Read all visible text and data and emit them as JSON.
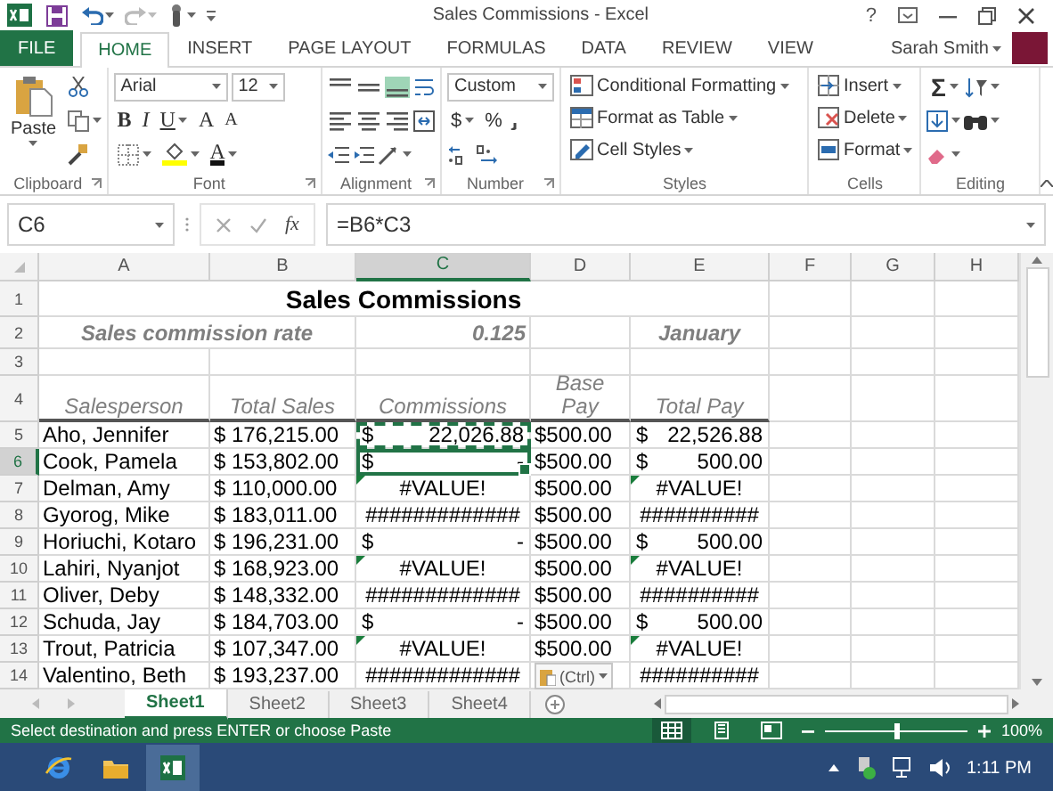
{
  "window": {
    "title": "Sales Commissions - Excel",
    "help": "?",
    "account": "Sarah Smith"
  },
  "ribbon_tabs": [
    {
      "label": "FILE",
      "kind": "file",
      "selected": false
    },
    {
      "label": "HOME",
      "kind": "tab",
      "selected": true
    },
    {
      "label": "INSERT",
      "kind": "tab",
      "selected": false
    },
    {
      "label": "PAGE LAYOUT",
      "kind": "tab",
      "selected": false
    },
    {
      "label": "FORMULAS",
      "kind": "tab",
      "selected": false
    },
    {
      "label": "DATA",
      "kind": "tab",
      "selected": false
    },
    {
      "label": "REVIEW",
      "kind": "tab",
      "selected": false
    },
    {
      "label": "VIEW",
      "kind": "tab",
      "selected": false
    }
  ],
  "ribbon": {
    "clipboard": {
      "paste": "Paste",
      "label": "Clipboard"
    },
    "font": {
      "name": "Arial",
      "size": "12",
      "bold": "B",
      "italic": "I",
      "underline": "U",
      "grow": "A",
      "shrink": "A",
      "font_color": "A",
      "label": "Font"
    },
    "alignment": {
      "label": "Alignment"
    },
    "number": {
      "format": "Custom",
      "currency": "$",
      "percent": "%",
      "label": "Number"
    },
    "styles": {
      "items": [
        "Conditional Formatting",
        "Format as Table",
        "Cell Styles"
      ],
      "label": "Styles"
    },
    "cells": {
      "items": [
        "Insert",
        "Delete",
        "Format"
      ],
      "label": "Cells"
    },
    "editing": {
      "sum": "Σ",
      "label": "Editing"
    }
  },
  "formula_bar": {
    "name_box": "C6",
    "insert_function": "fx",
    "formula": "=B6*C3"
  },
  "sheet": {
    "columns": [
      {
        "label": "A",
        "selected": false
      },
      {
        "label": "B",
        "selected": false
      },
      {
        "label": "C",
        "selected": true
      },
      {
        "label": "D",
        "selected": false
      },
      {
        "label": "E",
        "selected": false
      },
      {
        "label": "F",
        "selected": false
      },
      {
        "label": "G",
        "selected": false
      },
      {
        "label": "H",
        "selected": false
      }
    ],
    "top_rows": [
      {
        "label": "1",
        "selected": false
      },
      {
        "label": "2",
        "selected": false
      },
      {
        "label": "3",
        "selected": false
      },
      {
        "label": "4",
        "selected": false
      }
    ],
    "title": "Sales Commissions",
    "rate_label": "Sales commission rate",
    "rate": "0.125",
    "month": "January",
    "headers": [
      "Salesperson",
      "Total Sales",
      "Commissions",
      "Base Pay",
      "Total Pay"
    ],
    "rows": [
      {
        "label": "5",
        "selected": false,
        "name": "Aho, Jennifer",
        "total_sales": "$ 176,215.00",
        "commission": {
          "kind": "accounting",
          "symbol": "$",
          "value": "22,026.88",
          "flagged": false,
          "marquee": true,
          "active": false
        },
        "base_pay": "$500.00",
        "total_pay": {
          "kind": "accounting",
          "symbol": "$",
          "value": "22,526.88",
          "flagged": false
        }
      },
      {
        "label": "6",
        "selected": true,
        "name": "Cook, Pamela",
        "total_sales": "$ 153,802.00",
        "commission": {
          "kind": "accounting",
          "symbol": "$",
          "value": "-",
          "flagged": false,
          "marquee": false,
          "active": true
        },
        "base_pay": "$500.00",
        "total_pay": {
          "kind": "accounting",
          "symbol": "$",
          "value": "500.00",
          "flagged": false
        }
      },
      {
        "label": "7",
        "selected": false,
        "name": "Delman, Amy",
        "total_sales": "$ 110,000.00",
        "commission": {
          "kind": "error",
          "text": "#VALUE!",
          "flagged": true,
          "marquee": false,
          "active": false
        },
        "base_pay": "$500.00",
        "total_pay": {
          "kind": "error",
          "text": "#VALUE!",
          "flagged": true
        }
      },
      {
        "label": "8",
        "selected": false,
        "name": "Gyorog, Mike",
        "total_sales": "$ 183,011.00",
        "commission": {
          "kind": "overflow",
          "text": "#############",
          "flagged": false,
          "marquee": false,
          "active": false
        },
        "base_pay": "$500.00",
        "total_pay": {
          "kind": "overflow",
          "text": "##########",
          "flagged": false
        }
      },
      {
        "label": "9",
        "selected": false,
        "name": "Horiuchi, Kotaro",
        "total_sales": "$ 196,231.00",
        "commission": {
          "kind": "accounting",
          "symbol": "$",
          "value": "-",
          "flagged": false,
          "marquee": false,
          "active": false
        },
        "base_pay": "$500.00",
        "total_pay": {
          "kind": "accounting",
          "symbol": "$",
          "value": "500.00",
          "flagged": false
        }
      },
      {
        "label": "10",
        "selected": false,
        "name": "Lahiri, Nyanjot",
        "total_sales": "$ 168,923.00",
        "commission": {
          "kind": "error",
          "text": "#VALUE!",
          "flagged": true,
          "marquee": false,
          "active": false
        },
        "base_pay": "$500.00",
        "total_pay": {
          "kind": "error",
          "text": "#VALUE!",
          "flagged": true
        }
      },
      {
        "label": "11",
        "selected": false,
        "name": "Oliver, Deby",
        "total_sales": "$ 148,332.00",
        "commission": {
          "kind": "overflow",
          "text": "#############",
          "flagged": false,
          "marquee": false,
          "active": false
        },
        "base_pay": "$500.00",
        "total_pay": {
          "kind": "overflow",
          "text": "##########",
          "flagged": false
        }
      },
      {
        "label": "12",
        "selected": false,
        "name": "Schuda, Jay",
        "total_sales": "$ 184,703.00",
        "commission": {
          "kind": "accounting",
          "symbol": "$",
          "value": "-",
          "flagged": false,
          "marquee": false,
          "active": false
        },
        "base_pay": "$500.00",
        "total_pay": {
          "kind": "accounting",
          "symbol": "$",
          "value": "500.00",
          "flagged": false
        }
      },
      {
        "label": "13",
        "selected": false,
        "name": "Trout, Patricia",
        "total_sales": "$ 107,347.00",
        "commission": {
          "kind": "error",
          "text": "#VALUE!",
          "flagged": true,
          "marquee": false,
          "active": false
        },
        "base_pay": "$500.00",
        "total_pay": {
          "kind": "error",
          "text": "#VALUE!",
          "flagged": true
        }
      },
      {
        "label": "14",
        "selected": false,
        "name": "Valentino, Beth",
        "total_sales": "$ 193,237.00",
        "commission": {
          "kind": "overflow",
          "text": "#############",
          "flagged": false,
          "marquee": false,
          "active": false
        },
        "total_pay": {
          "kind": "overflow",
          "text": "##########",
          "flagged": false
        }
      }
    ],
    "paste_options": "(Ctrl)"
  },
  "sheet_tabs": [
    {
      "label": "Sheet1",
      "selected": true
    },
    {
      "label": "Sheet2",
      "selected": false
    },
    {
      "label": "Sheet3",
      "selected": false
    },
    {
      "label": "Sheet4",
      "selected": false
    }
  ],
  "status_bar": {
    "message": "Select destination and press ENTER or choose Paste",
    "views": [
      {
        "kind": "normal",
        "selected": true
      },
      {
        "kind": "page_layout",
        "selected": false
      },
      {
        "kind": "page_break",
        "selected": false
      }
    ],
    "zoom": {
      "level": 0.5
    },
    "zoom_label": "100%"
  },
  "taskbar": {
    "apps": [
      {
        "kind": "browser",
        "selected": false
      },
      {
        "kind": "folder",
        "selected": false
      },
      {
        "kind": "excel",
        "selected": true
      }
    ],
    "clock": "1:11 PM"
  }
}
